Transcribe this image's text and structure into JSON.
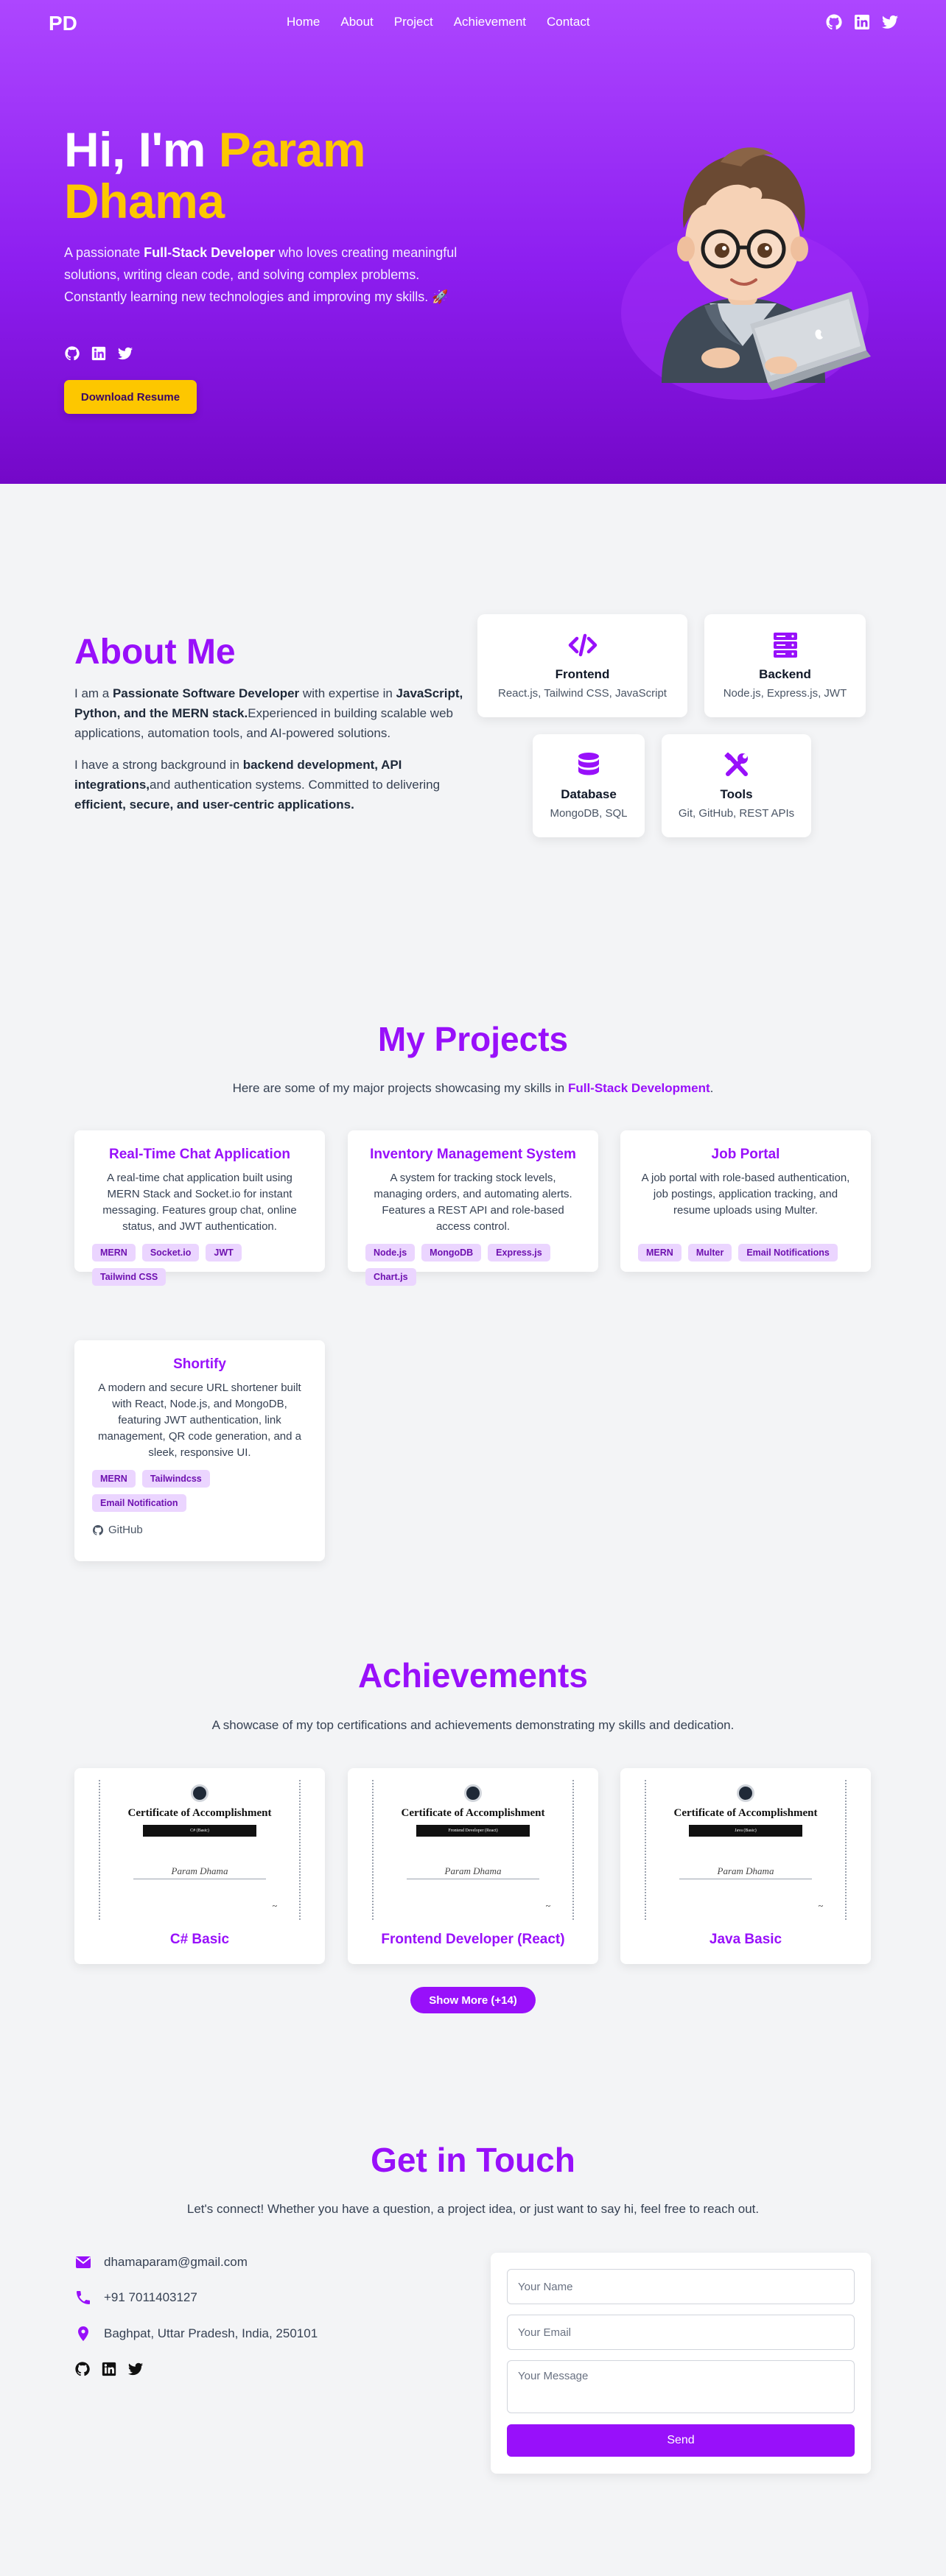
{
  "nav": {
    "logo": "PD",
    "links": [
      "Home",
      "About",
      "Project",
      "Achievement",
      "Contact"
    ],
    "icons": [
      "github-icon",
      "linkedin-icon",
      "twitter-icon"
    ]
  },
  "hero": {
    "greeting": "Hi, I'm",
    "name_first": "Param",
    "name_last": "Dhama",
    "desc_prefix": "A passionate ",
    "desc_bold": "Full-Stack Developer",
    "desc_suffix": " who loves creating meaningful solutions, writing clean code, and solving complex problems. Constantly learning new technologies and improving my skills. 🚀",
    "resume_button": "Download Resume",
    "colors": {
      "accent": "#fdc700",
      "brand": "#9810fa"
    }
  },
  "about": {
    "title": "About Me",
    "p1": [
      {
        "t": "I am a ",
        "b": false
      },
      {
        "t": "Passionate Software Developer",
        "b": true
      },
      {
        "t": " with expertise in ",
        "b": false
      },
      {
        "t": "JavaScript, Python, and the MERN stack.",
        "b": true
      },
      {
        "t": "Experienced in building scalable web applications, automation tools, and AI-powered solutions.",
        "b": false
      }
    ],
    "p2": [
      {
        "t": "I have a strong background in ",
        "b": false
      },
      {
        "t": "backend development, API integrations,",
        "b": true
      },
      {
        "t": "and authentication systems. Committed to delivering ",
        "b": false
      },
      {
        "t": "efficient, secure, and user-centric applications.",
        "b": true
      }
    ],
    "skills": [
      {
        "name": "Frontend",
        "desc": "React.js, Tailwind CSS, JavaScript",
        "icon": "code-icon"
      },
      {
        "name": "Backend",
        "desc": "Node.js, Express.js, JWT",
        "icon": "server-icon"
      },
      {
        "name": "Database",
        "desc": "MongoDB, SQL",
        "icon": "database-icon"
      },
      {
        "name": "Tools",
        "desc": "Git, GitHub, REST APIs",
        "icon": "tools-icon"
      }
    ]
  },
  "projects": {
    "title": "My Projects",
    "subtitle_prefix": "Here are some of my major projects showcasing my skills in ",
    "subtitle_bold": "Full-Stack Development",
    "subtitle_suffix": ".",
    "items": [
      {
        "title": "Real-Time Chat Application",
        "desc": "A real-time chat application built using MERN Stack and Socket.io for instant messaging. Features group chat, online status, and JWT authentication.",
        "tags": [
          "MERN",
          "Socket.io",
          "JWT",
          "Tailwind CSS"
        ]
      },
      {
        "title": "Inventory Management System",
        "desc": "A system for tracking stock levels, managing orders, and automating alerts. Features a REST API and role-based access control.",
        "tags": [
          "Node.js",
          "MongoDB",
          "Express.js",
          "Chart.js"
        ]
      },
      {
        "title": "Job Portal",
        "desc": "A job portal with role-based authentication, job postings, application tracking, and resume uploads using Multer.",
        "tags": [
          "MERN",
          "Multer",
          "Email Notifications"
        ]
      },
      {
        "title": "Shortify",
        "desc": "A modern and secure URL shortener built with React, Node.js, and MongoDB, featuring JWT authentication, link management, QR code generation, and a sleek, responsive UI.",
        "tags": [
          "MERN",
          "Tailwindcss",
          "Email Notification"
        ],
        "link": "GitHub"
      }
    ]
  },
  "achievements": {
    "title": "Achievements",
    "subtitle": "A showcase of my top certifications and achievements demonstrating my skills and dedication.",
    "cert_heading": "Certificate of Accomplishment",
    "cert_name": "Param Dhama",
    "items": [
      {
        "title": "C# Basic",
        "ribbon": "C# (Basic)"
      },
      {
        "title": "Frontend Developer (React)",
        "ribbon": "Frontend Developer (React)"
      },
      {
        "title": "Java Basic",
        "ribbon": "Java (Basic)"
      }
    ],
    "show_more": "Show More (+14)"
  },
  "contact": {
    "title": "Get in Touch",
    "subtitle": "Let's connect! Whether you have a question, a project idea, or just want to say hi, feel free to reach out.",
    "email": "dhamaparam@gmail.com",
    "phone": "+91 7011403127",
    "address": "Baghpat, Uttar Pradesh, India, 250101",
    "form": {
      "name_placeholder": "Your Name",
      "email_placeholder": "Your Email",
      "message_placeholder": "Your Message",
      "send": "Send"
    }
  }
}
